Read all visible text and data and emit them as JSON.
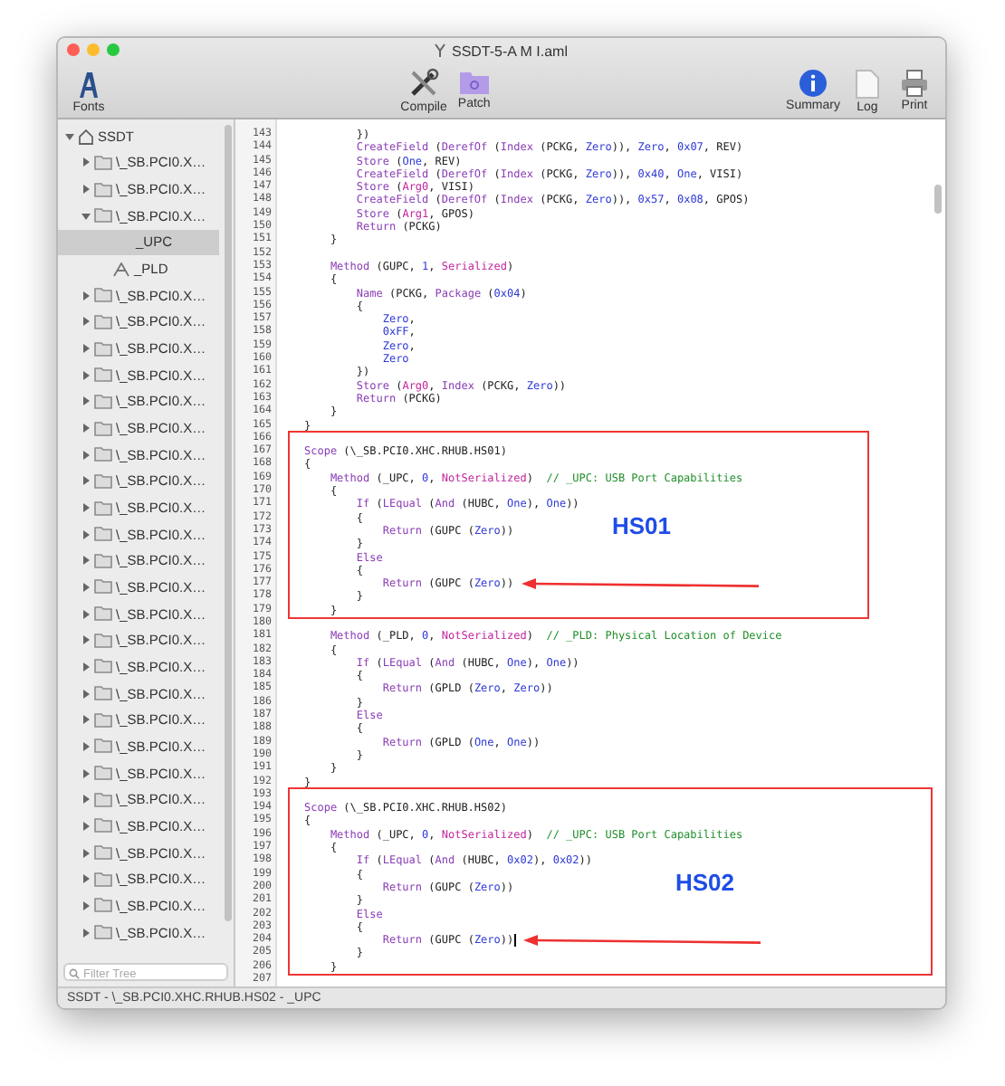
{
  "window": {
    "title": "SSDT-5-A M I.aml"
  },
  "toolbar": {
    "left": [
      {
        "label": "Fonts",
        "kind": "fonts"
      }
    ],
    "center": [
      {
        "label": "Compile",
        "kind": "compile"
      },
      {
        "label": "Patch",
        "kind": "patch"
      }
    ],
    "right": [
      {
        "label": "Summary",
        "kind": "summary"
      },
      {
        "label": "Log",
        "kind": "log"
      },
      {
        "label": "Print",
        "kind": "print"
      }
    ]
  },
  "tree": {
    "label": "SSDT",
    "expanded": true,
    "selected": false,
    "children": [
      {
        "label": "\\_SB.PCI0.X…",
        "expanded": false,
        "selected": false
      },
      {
        "label": "\\_SB.PCI0.X…",
        "expanded": false,
        "selected": false
      },
      {
        "label": "\\_SB.PCI0.X…",
        "expanded": true,
        "selected": false,
        "children": [
          {
            "label": "_UPC",
            "kind": "plain",
            "selected": true
          },
          {
            "label": "_PLD",
            "kind": "method",
            "selected": false
          }
        ]
      },
      {
        "label": "\\_SB.PCI0.X…",
        "expanded": false,
        "selected": false
      },
      {
        "label": "\\_SB.PCI0.X…",
        "expanded": false,
        "selected": false
      },
      {
        "label": "\\_SB.PCI0.X…",
        "expanded": false,
        "selected": false
      },
      {
        "label": "\\_SB.PCI0.X…",
        "expanded": false,
        "selected": false
      },
      {
        "label": "\\_SB.PCI0.X…",
        "expanded": false,
        "selected": false
      },
      {
        "label": "\\_SB.PCI0.X…",
        "expanded": false,
        "selected": false
      },
      {
        "label": "\\_SB.PCI0.X…",
        "expanded": false,
        "selected": false
      },
      {
        "label": "\\_SB.PCI0.X…",
        "expanded": false,
        "selected": false
      },
      {
        "label": "\\_SB.PCI0.X…",
        "expanded": false,
        "selected": false
      },
      {
        "label": "\\_SB.PCI0.X…",
        "expanded": false,
        "selected": false
      },
      {
        "label": "\\_SB.PCI0.X…",
        "expanded": false,
        "selected": false
      },
      {
        "label": "\\_SB.PCI0.X…",
        "expanded": false,
        "selected": false
      },
      {
        "label": "\\_SB.PCI0.X…",
        "expanded": false,
        "selected": false
      },
      {
        "label": "\\_SB.PCI0.X…",
        "expanded": false,
        "selected": false
      },
      {
        "label": "\\_SB.PCI0.X…",
        "expanded": false,
        "selected": false
      },
      {
        "label": "\\_SB.PCI0.X…",
        "expanded": false,
        "selected": false
      },
      {
        "label": "\\_SB.PCI0.X…",
        "expanded": false,
        "selected": false
      },
      {
        "label": "\\_SB.PCI0.X…",
        "expanded": false,
        "selected": false
      },
      {
        "label": "\\_SB.PCI0.X…",
        "expanded": false,
        "selected": false
      },
      {
        "label": "\\_SB.PCI0.X…",
        "expanded": false,
        "selected": false
      },
      {
        "label": "\\_SB.PCI0.X…",
        "expanded": false,
        "selected": false
      },
      {
        "label": "\\_SB.PCI0.X…",
        "expanded": false,
        "selected": false
      },
      {
        "label": "\\_SB.PCI0.X…",
        "expanded": false,
        "selected": false
      },
      {
        "label": "\\_SB.PCI0.X…",
        "expanded": false,
        "selected": false
      },
      {
        "label": "\\_SB.PCI0.X…",
        "expanded": false,
        "selected": false
      }
    ]
  },
  "filter": {
    "placeholder": "Filter Tree"
  },
  "editor": {
    "blocks": [
      {
        "kind": "plain",
        "lines": [
          {
            "n": "143",
            "code": [
              {
                "text": "        })",
                "kind": "plain"
              }
            ]
          },
          {
            "n": "144",
            "code": [
              {
                "text": "        CreateField",
                "kind": "keyword"
              },
              {
                "text": " (",
                "kind": "plain"
              },
              {
                "text": "DerefOf",
                "kind": "keyword"
              },
              {
                "text": " (",
                "kind": "plain"
              },
              {
                "text": "Index",
                "kind": "keyword"
              },
              {
                "text": " (PCKG, ",
                "kind": "plain"
              },
              {
                "text": "Zero",
                "kind": "constant"
              },
              {
                "text": ")), ",
                "kind": "plain"
              },
              {
                "text": "Zero",
                "kind": "constant"
              },
              {
                "text": ", ",
                "kind": "plain"
              },
              {
                "text": "0x07",
                "kind": "constant"
              },
              {
                "text": ", REV)",
                "kind": "plain"
              }
            ]
          },
          {
            "n": "145",
            "code": [
              {
                "text": "        Store",
                "kind": "keyword"
              },
              {
                "text": " (",
                "kind": "plain"
              },
              {
                "text": "One",
                "kind": "constant"
              },
              {
                "text": ", REV)",
                "kind": "plain"
              }
            ]
          },
          {
            "n": "146",
            "code": [
              {
                "text": "        CreateField",
                "kind": "keyword"
              },
              {
                "text": " (",
                "kind": "plain"
              },
              {
                "text": "DerefOf",
                "kind": "keyword"
              },
              {
                "text": " (",
                "kind": "plain"
              },
              {
                "text": "Index",
                "kind": "keyword"
              },
              {
                "text": " (PCKG, ",
                "kind": "plain"
              },
              {
                "text": "Zero",
                "kind": "constant"
              },
              {
                "text": ")), ",
                "kind": "plain"
              },
              {
                "text": "0x40",
                "kind": "constant"
              },
              {
                "text": ", ",
                "kind": "plain"
              },
              {
                "text": "One",
                "kind": "constant"
              },
              {
                "text": ", VISI)",
                "kind": "plain"
              }
            ]
          },
          {
            "n": "147",
            "code": [
              {
                "text": "        Store",
                "kind": "keyword"
              },
              {
                "text": " (",
                "kind": "plain"
              },
              {
                "text": "Arg0",
                "kind": "argument"
              },
              {
                "text": ", VISI)",
                "kind": "plain"
              }
            ]
          },
          {
            "n": "148",
            "code": [
              {
                "text": "        CreateField",
                "kind": "keyword"
              },
              {
                "text": " (",
                "kind": "plain"
              },
              {
                "text": "DerefOf",
                "kind": "keyword"
              },
              {
                "text": " (",
                "kind": "plain"
              },
              {
                "text": "Index",
                "kind": "keyword"
              },
              {
                "text": " (PCKG, ",
                "kind": "plain"
              },
              {
                "text": "Zero",
                "kind": "constant"
              },
              {
                "text": ")), ",
                "kind": "plain"
              },
              {
                "text": "0x57",
                "kind": "constant"
              },
              {
                "text": ", ",
                "kind": "plain"
              },
              {
                "text": "0x08",
                "kind": "constant"
              },
              {
                "text": ", GPOS)",
                "kind": "plain"
              }
            ]
          },
          {
            "n": "149",
            "code": [
              {
                "text": "        Store",
                "kind": "keyword"
              },
              {
                "text": " (",
                "kind": "plain"
              },
              {
                "text": "Arg1",
                "kind": "argument"
              },
              {
                "text": ", GPOS)",
                "kind": "plain"
              }
            ]
          },
          {
            "n": "150",
            "code": [
              {
                "text": "        Return",
                "kind": "keyword"
              },
              {
                "text": " (PCKG)",
                "kind": "plain"
              }
            ]
          },
          {
            "n": "151",
            "code": [
              {
                "text": "    }",
                "kind": "plain"
              }
            ]
          },
          {
            "n": "152"
          },
          {
            "n": "153",
            "code": [
              {
                "text": "    Method",
                "kind": "keyword"
              },
              {
                "text": " (GUPC, ",
                "kind": "plain"
              },
              {
                "text": "1",
                "kind": "constant"
              },
              {
                "text": ", ",
                "kind": "plain"
              },
              {
                "text": "Serialized",
                "kind": "argument"
              },
              {
                "text": ")",
                "kind": "plain"
              }
            ]
          },
          {
            "n": "154",
            "code": [
              {
                "text": "    {",
                "kind": "plain"
              }
            ]
          },
          {
            "n": "155",
            "code": [
              {
                "text": "        Name",
                "kind": "keyword"
              },
              {
                "text": " (PCKG, ",
                "kind": "plain"
              },
              {
                "text": "Package",
                "kind": "keyword"
              },
              {
                "text": " (",
                "kind": "plain"
              },
              {
                "text": "0x04",
                "kind": "constant"
              },
              {
                "text": ")",
                "kind": "plain"
              }
            ]
          },
          {
            "n": "156",
            "code": [
              {
                "text": "        {",
                "kind": "plain"
              }
            ]
          },
          {
            "n": "157",
            "code": [
              {
                "text": "            Zero",
                "kind": "constant"
              },
              {
                "text": ",",
                "kind": "plain"
              }
            ]
          },
          {
            "n": "158",
            "code": [
              {
                "text": "            0xFF",
                "kind": "constant"
              },
              {
                "text": ",",
                "kind": "plain"
              }
            ]
          },
          {
            "n": "159",
            "code": [
              {
                "text": "            Zero",
                "kind": "constant"
              },
              {
                "text": ",",
                "kind": "plain"
              }
            ]
          },
          {
            "n": "160",
            "code": [
              {
                "text": "            Zero",
                "kind": "constant"
              }
            ]
          },
          {
            "n": "161",
            "code": [
              {
                "text": "        })",
                "kind": "plain"
              }
            ]
          },
          {
            "n": "162",
            "code": [
              {
                "text": "        Store",
                "kind": "keyword"
              },
              {
                "text": " (",
                "kind": "plain"
              },
              {
                "text": "Arg0",
                "kind": "argument"
              },
              {
                "text": ", ",
                "kind": "plain"
              },
              {
                "text": "Index",
                "kind": "keyword"
              },
              {
                "text": " (PCKG, ",
                "kind": "plain"
              },
              {
                "text": "Zero",
                "kind": "constant"
              },
              {
                "text": "))",
                "kind": "plain"
              }
            ]
          },
          {
            "n": "163",
            "code": [
              {
                "text": "        Return",
                "kind": "keyword"
              },
              {
                "text": " (PCKG)",
                "kind": "plain"
              }
            ]
          },
          {
            "n": "164",
            "code": [
              {
                "text": "    }",
                "kind": "plain"
              }
            ]
          },
          {
            "n": "165",
            "code": [
              {
                "text": "}",
                "kind": "plain"
              }
            ]
          }
        ]
      },
      {
        "kind": "highlight",
        "label": "HS01",
        "lines": [
          {
            "n": "166"
          },
          {
            "n": "167",
            "code": [
              {
                "text": "Scope",
                "kind": "keyword"
              },
              {
                "text": " (\\_SB.PCI0.XHC.RHUB.HS01)",
                "kind": "plain"
              }
            ]
          },
          {
            "n": "168",
            "code": [
              {
                "text": "{",
                "kind": "plain"
              }
            ]
          },
          {
            "n": "169",
            "code": [
              {
                "text": "    Method",
                "kind": "keyword"
              },
              {
                "text": " (_UPC, ",
                "kind": "plain"
              },
              {
                "text": "0",
                "kind": "constant"
              },
              {
                "text": ", ",
                "kind": "plain"
              },
              {
                "text": "NotSerialized",
                "kind": "argument"
              },
              {
                "text": ")  ",
                "kind": "plain"
              },
              {
                "text": "// _UPC: USB Port Capabilities",
                "kind": "comment"
              }
            ]
          },
          {
            "n": "170",
            "code": [
              {
                "text": "    {",
                "kind": "plain"
              }
            ]
          },
          {
            "n": "171",
            "code": [
              {
                "text": "        If",
                "kind": "keyword"
              },
              {
                "text": " (",
                "kind": "plain"
              },
              {
                "text": "LEqual",
                "kind": "keyword"
              },
              {
                "text": " (",
                "kind": "plain"
              },
              {
                "text": "And",
                "kind": "keyword"
              },
              {
                "text": " (HUBC, ",
                "kind": "plain"
              },
              {
                "text": "One",
                "kind": "constant"
              },
              {
                "text": "), ",
                "kind": "plain"
              },
              {
                "text": "One",
                "kind": "constant"
              },
              {
                "text": "))",
                "kind": "plain"
              }
            ]
          },
          {
            "n": "172",
            "code": [
              {
                "text": "        {",
                "kind": "plain"
              }
            ]
          },
          {
            "n": "173",
            "code": [
              {
                "text": "            Return",
                "kind": "keyword"
              },
              {
                "text": " (GUPC (",
                "kind": "plain"
              },
              {
                "text": "Zero",
                "kind": "constant"
              },
              {
                "text": "))",
                "kind": "plain"
              }
            ]
          },
          {
            "n": "174",
            "code": [
              {
                "text": "        }",
                "kind": "plain"
              }
            ]
          },
          {
            "n": "175",
            "code": [
              {
                "text": "        Else",
                "kind": "keyword"
              }
            ]
          },
          {
            "n": "176",
            "code": [
              {
                "text": "        {",
                "kind": "plain"
              }
            ]
          },
          {
            "n": "177",
            "code": [
              {
                "text": "            Return",
                "kind": "keyword"
              },
              {
                "text": " (GUPC (",
                "kind": "plain"
              },
              {
                "text": "Zero",
                "kind": "constant"
              },
              {
                "text": "))",
                "kind": "plain"
              }
            ],
            "arrow": true
          },
          {
            "n": "178",
            "code": [
              {
                "text": "        }",
                "kind": "plain"
              }
            ]
          },
          {
            "n": "179",
            "code": [
              {
                "text": "    }",
                "kind": "plain"
              }
            ]
          }
        ]
      },
      {
        "kind": "plain",
        "lines": [
          {
            "n": "180"
          },
          {
            "n": "181",
            "code": [
              {
                "text": "    Method",
                "kind": "keyword"
              },
              {
                "text": " (_PLD, ",
                "kind": "plain"
              },
              {
                "text": "0",
                "kind": "constant"
              },
              {
                "text": ", ",
                "kind": "plain"
              },
              {
                "text": "NotSerialized",
                "kind": "argument"
              },
              {
                "text": ")  ",
                "kind": "plain"
              },
              {
                "text": "// _PLD: Physical Location of Device",
                "kind": "comment"
              }
            ]
          },
          {
            "n": "182",
            "code": [
              {
                "text": "    {",
                "kind": "plain"
              }
            ]
          },
          {
            "n": "183",
            "code": [
              {
                "text": "        If",
                "kind": "keyword"
              },
              {
                "text": " (",
                "kind": "plain"
              },
              {
                "text": "LEqual",
                "kind": "keyword"
              },
              {
                "text": " (",
                "kind": "plain"
              },
              {
                "text": "And",
                "kind": "keyword"
              },
              {
                "text": " (HUBC, ",
                "kind": "plain"
              },
              {
                "text": "One",
                "kind": "constant"
              },
              {
                "text": "), ",
                "kind": "plain"
              },
              {
                "text": "One",
                "kind": "constant"
              },
              {
                "text": "))",
                "kind": "plain"
              }
            ]
          },
          {
            "n": "184",
            "code": [
              {
                "text": "        {",
                "kind": "plain"
              }
            ]
          },
          {
            "n": "185",
            "code": [
              {
                "text": "            Return",
                "kind": "keyword"
              },
              {
                "text": " (GPLD (",
                "kind": "plain"
              },
              {
                "text": "Zero",
                "kind": "constant"
              },
              {
                "text": ", ",
                "kind": "plain"
              },
              {
                "text": "Zero",
                "kind": "constant"
              },
              {
                "text": "))",
                "kind": "plain"
              }
            ]
          },
          {
            "n": "186",
            "code": [
              {
                "text": "        }",
                "kind": "plain"
              }
            ]
          },
          {
            "n": "187",
            "code": [
              {
                "text": "        Else",
                "kind": "keyword"
              }
            ]
          },
          {
            "n": "188",
            "code": [
              {
                "text": "        {",
                "kind": "plain"
              }
            ]
          },
          {
            "n": "189",
            "code": [
              {
                "text": "            Return",
                "kind": "keyword"
              },
              {
                "text": " (GPLD (",
                "kind": "plain"
              },
              {
                "text": "One",
                "kind": "constant"
              },
              {
                "text": ", ",
                "kind": "plain"
              },
              {
                "text": "One",
                "kind": "constant"
              },
              {
                "text": "))",
                "kind": "plain"
              }
            ]
          },
          {
            "n": "190",
            "code": [
              {
                "text": "        }",
                "kind": "plain"
              }
            ]
          },
          {
            "n": "191",
            "code": [
              {
                "text": "    }",
                "kind": "plain"
              }
            ]
          },
          {
            "n": "192",
            "code": [
              {
                "text": "}",
                "kind": "plain"
              }
            ]
          }
        ]
      },
      {
        "kind": "highlight",
        "label": "HS02",
        "lines": [
          {
            "n": "193"
          },
          {
            "n": "194",
            "code": [
              {
                "text": "Scope",
                "kind": "keyword"
              },
              {
                "text": " (\\_SB.PCI0.XHC.RHUB.HS02)",
                "kind": "plain"
              }
            ]
          },
          {
            "n": "195",
            "code": [
              {
                "text": "{",
                "kind": "plain"
              }
            ]
          },
          {
            "n": "196",
            "code": [
              {
                "text": "    Method",
                "kind": "keyword"
              },
              {
                "text": " (_UPC, ",
                "kind": "plain"
              },
              {
                "text": "0",
                "kind": "constant"
              },
              {
                "text": ", ",
                "kind": "plain"
              },
              {
                "text": "NotSerialized",
                "kind": "argument"
              },
              {
                "text": ")  ",
                "kind": "plain"
              },
              {
                "text": "// _UPC: USB Port Capabilities",
                "kind": "comment"
              }
            ]
          },
          {
            "n": "197",
            "code": [
              {
                "text": "    {",
                "kind": "plain"
              }
            ]
          },
          {
            "n": "198",
            "code": [
              {
                "text": "        If",
                "kind": "keyword"
              },
              {
                "text": " (",
                "kind": "plain"
              },
              {
                "text": "LEqual",
                "kind": "keyword"
              },
              {
                "text": " (",
                "kind": "plain"
              },
              {
                "text": "And",
                "kind": "keyword"
              },
              {
                "text": " (HUBC, ",
                "kind": "plain"
              },
              {
                "text": "0x02",
                "kind": "constant"
              },
              {
                "text": "), ",
                "kind": "plain"
              },
              {
                "text": "0x02",
                "kind": "constant"
              },
              {
                "text": "))",
                "kind": "plain"
              }
            ]
          },
          {
            "n": "199",
            "code": [
              {
                "text": "        {",
                "kind": "plain"
              }
            ]
          },
          {
            "n": "200",
            "code": [
              {
                "text": "            Return",
                "kind": "keyword"
              },
              {
                "text": " (GUPC (",
                "kind": "plain"
              },
              {
                "text": "Zero",
                "kind": "constant"
              },
              {
                "text": "))",
                "kind": "plain"
              }
            ]
          },
          {
            "n": "201",
            "code": [
              {
                "text": "        }",
                "kind": "plain"
              }
            ]
          },
          {
            "n": "202",
            "code": [
              {
                "text": "        Else",
                "kind": "keyword"
              }
            ]
          },
          {
            "n": "203",
            "code": [
              {
                "text": "        {",
                "kind": "plain"
              }
            ]
          },
          {
            "n": "204",
            "code": [
              {
                "text": "            Return",
                "kind": "keyword"
              },
              {
                "text": " (GUPC (",
                "kind": "plain"
              },
              {
                "text": "Zero",
                "kind": "constant"
              },
              {
                "text": "))",
                "kind": "plain"
              }
            ],
            "cursor": true,
            "arrow": true
          },
          {
            "n": "205",
            "code": [
              {
                "text": "        }",
                "kind": "plain"
              }
            ]
          },
          {
            "n": "206",
            "code": [
              {
                "text": "    }",
                "kind": "plain"
              }
            ]
          }
        ]
      },
      {
        "kind": "plain",
        "lines": [
          {
            "n": "207"
          }
        ]
      }
    ]
  },
  "status_bar": "SSDT - \\_SB.PCI0.XHC.RHUB.HS02 - _UPC"
}
